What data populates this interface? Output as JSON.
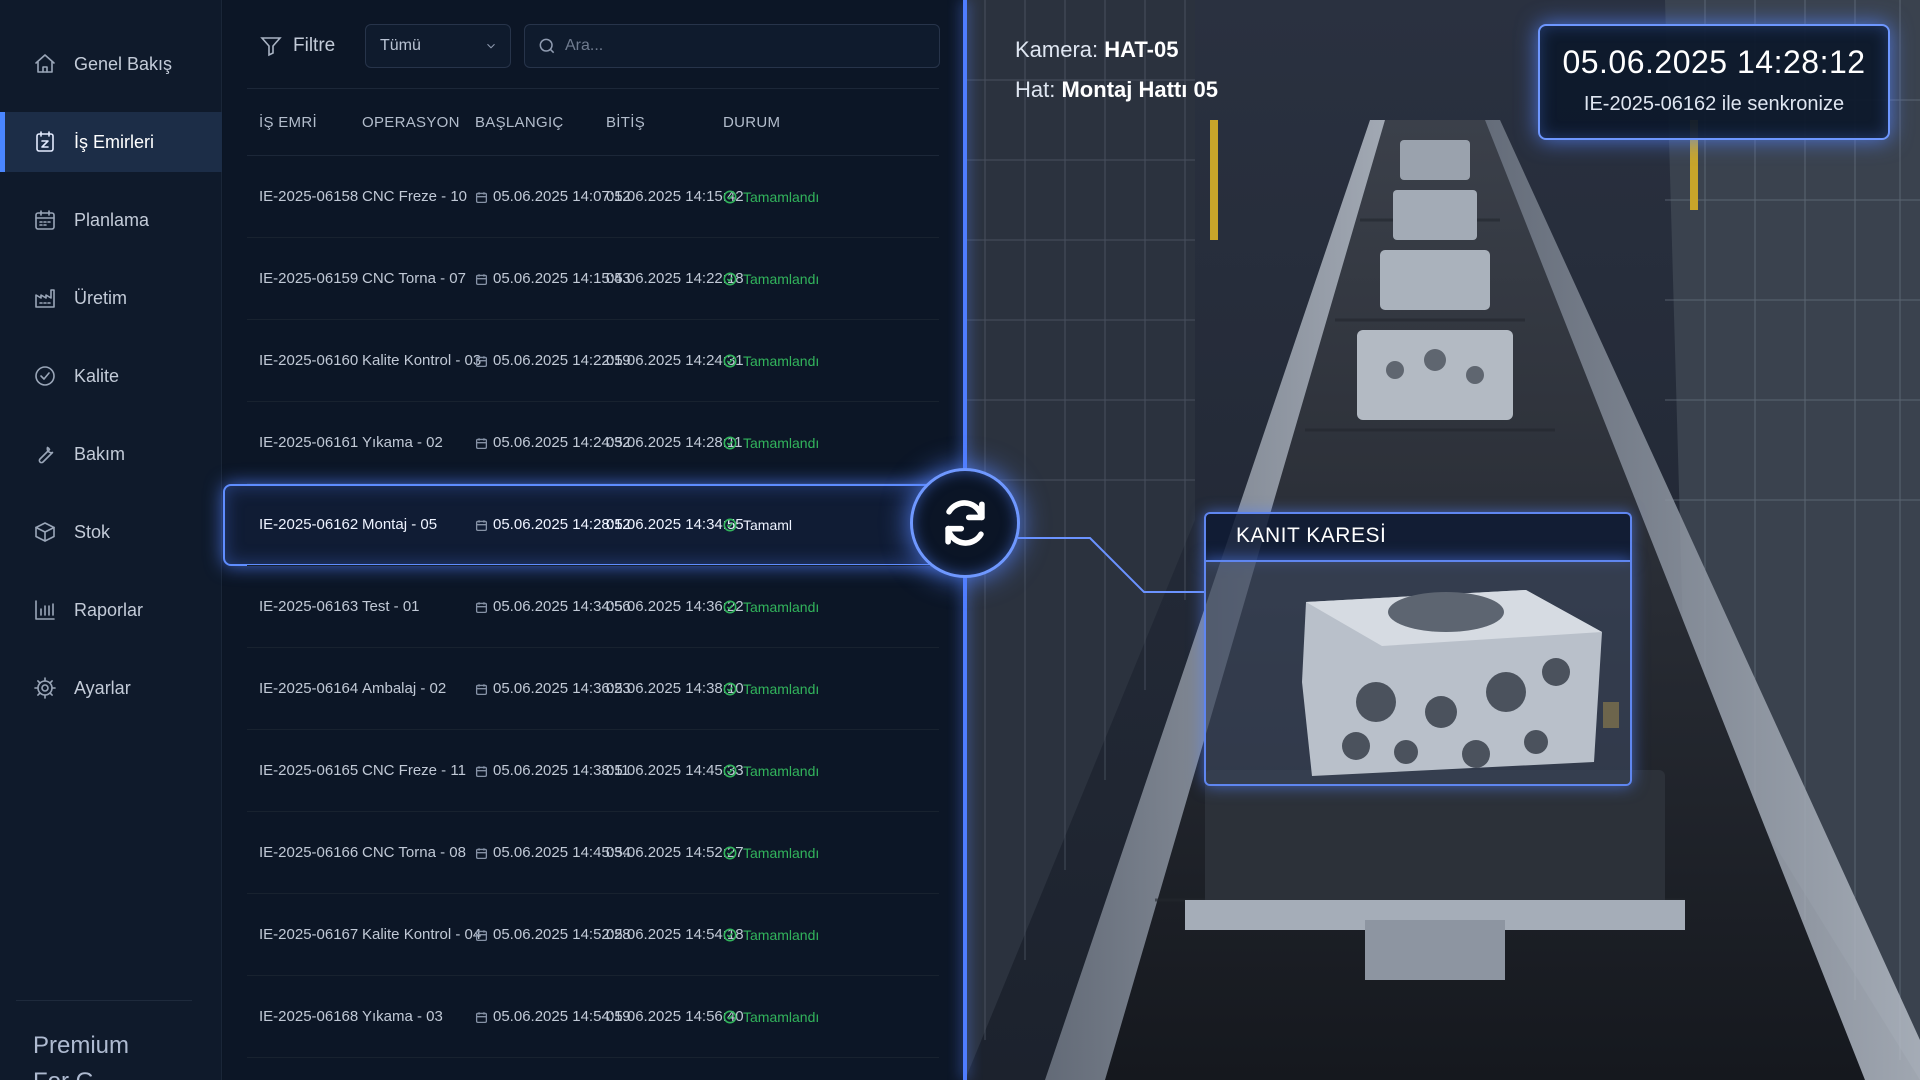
{
  "sidebar": {
    "items": [
      {
        "label": "Genel Bakış",
        "icon": "home-icon"
      },
      {
        "label": "İş Emirleri",
        "icon": "work-order-icon"
      },
      {
        "label": "Planlama",
        "icon": "calendar-icon"
      },
      {
        "label": "Üretim",
        "icon": "factory-icon"
      },
      {
        "label": "Kalite",
        "icon": "check-circle-icon"
      },
      {
        "label": "Bakım",
        "icon": "wrench-icon"
      },
      {
        "label": "Stok",
        "icon": "box-icon"
      },
      {
        "label": "Raporlar",
        "icon": "bar-chart-icon"
      },
      {
        "label": "Ayarlar",
        "icon": "gear-icon"
      }
    ],
    "active_index": 1,
    "premium_label": "Premium",
    "premium_sub": "For G..."
  },
  "toolbar": {
    "filter_label": "Filtre",
    "select_value": "Tümü",
    "search_placeholder": "Ara..."
  },
  "table": {
    "columns": [
      "İŞ EMRİ",
      "OPERASYON",
      "BAŞLANGIÇ",
      "BİTİŞ",
      "DURUM"
    ],
    "rows": [
      {
        "id": "IE-2025-06158",
        "op": "CNC Freze - 10",
        "start": "05.06.2025 14:07:12",
        "end": "05.06.2025 14:15:42",
        "status": "Tamamlandı"
      },
      {
        "id": "IE-2025-06159",
        "op": "CNC Torna - 07",
        "start": "05.06.2025 14:15:43",
        "end": "05.06.2025 14:22:18",
        "status": "Tamamlandı"
      },
      {
        "id": "IE-2025-06160",
        "op": "Kalite Kontrol - 03",
        "start": "05.06.2025 14:22:19",
        "end": "05.06.2025 14:24:31",
        "status": "Tamamlandı"
      },
      {
        "id": "IE-2025-06161",
        "op": "Yıkama - 02",
        "start": "05.06.2025 14:24:32",
        "end": "05.06.2025 14:28:11",
        "status": "Tamamlandı"
      },
      {
        "id": "IE-2025-06162",
        "op": "Montaj - 05",
        "start": "05.06.2025 14:28:12",
        "end": "05.06.2025 14:34:55",
        "status": "Tamamlandı"
      },
      {
        "id": "IE-2025-06163",
        "op": "Test - 01",
        "start": "05.06.2025 14:34:56",
        "end": "05.06.2025 14:36:22",
        "status": "Tamamlandı"
      },
      {
        "id": "IE-2025-06164",
        "op": "Ambalaj - 02",
        "start": "05.06.2025 14:36:23",
        "end": "05.06.2025 14:38:10",
        "status": "Tamamlandı"
      },
      {
        "id": "IE-2025-06165",
        "op": "CNC Freze - 11",
        "start": "05.06.2025 14:38:11",
        "end": "05.06.2025 14:45:33",
        "status": "Tamamlandı"
      },
      {
        "id": "IE-2025-06166",
        "op": "CNC Torna - 08",
        "start": "05.06.2025 14:45:34",
        "end": "05.06.2025 14:52:27",
        "status": "Tamamlandı"
      },
      {
        "id": "IE-2025-06167",
        "op": "Kalite Kontrol - 04",
        "start": "05.06.2025 14:52:28",
        "end": "05.06.2025 14:54:18",
        "status": "Tamamlandı"
      },
      {
        "id": "IE-2025-06168",
        "op": "Yıkama - 03",
        "start": "05.06.2025 14:54:19",
        "end": "05.06.2025 14:56:40",
        "status": "Tamamlandı"
      }
    ],
    "selected_index": 4,
    "selected_status_visible": "Tamaml"
  },
  "camera": {
    "camera_label": "Kamera:",
    "camera_value": "HAT-05",
    "line_label": "Hat:",
    "line_value": "Montaj Hattı 05",
    "timestamp": "05.06.2025 14:28:12",
    "sync_text": "IE-2025-06162 ile senkronize",
    "evidence_label": "KANIT KARESİ"
  },
  "colors": {
    "accent": "#4f7dff",
    "status_complete": "#32b45c",
    "sidebar_bg": "#0f1a2b",
    "panel_bg": "#0c1626"
  }
}
